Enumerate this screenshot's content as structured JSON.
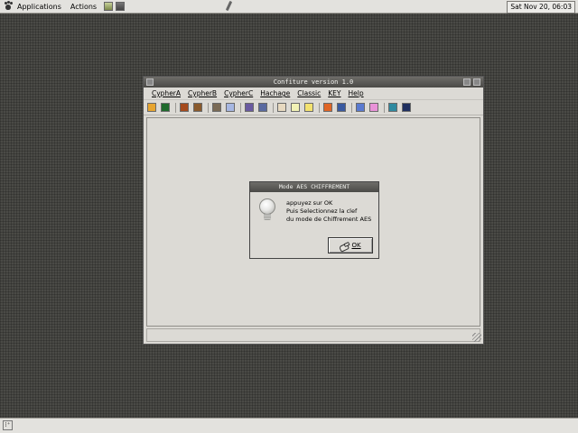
{
  "top_panel": {
    "menus": [
      "Applications",
      "Actions"
    ],
    "clock": "Sat Nov 20, 06:03"
  },
  "window": {
    "title": "Confiture version 1.0",
    "menu": [
      "CypherA",
      "CypherB",
      "CypherC",
      "Hachage",
      "Classic",
      "KEY",
      "Help"
    ],
    "toolbar_colors": [
      [
        "#e7a530",
        "#1f6a2c"
      ],
      [
        "#a54a1d",
        "#8a5a2c"
      ],
      [
        "#7a6a55",
        "#a7b7e2"
      ],
      [
        "#6a5aa0",
        "#5a6aa0"
      ],
      [
        "#e7d9c0",
        "#f2f2b5",
        "#f3e270"
      ],
      [
        "#e06525",
        "#3a5aa0"
      ],
      [
        "#5a7ad0",
        "#e993d8"
      ],
      [
        "#2f8aa0",
        "#1f2f60"
      ]
    ]
  },
  "dialog": {
    "title": "Mode AES CHIFFREMENT",
    "message": [
      "appuyez sur OK",
      "Puis Selectionnez la clef",
      "du mode de Chiffrement AES"
    ],
    "ok_label": "OK"
  },
  "bottom_panel": {
    "show_desktop_glyph": "⁞⁺"
  }
}
